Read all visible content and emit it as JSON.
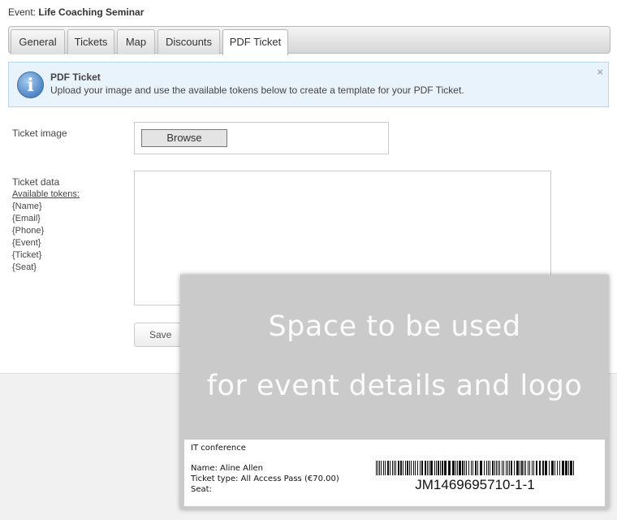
{
  "header": {
    "event_label": "Event:",
    "event_name": "Life Coaching Seminar"
  },
  "tabs": [
    {
      "label": "General"
    },
    {
      "label": "Tickets"
    },
    {
      "label": "Map"
    },
    {
      "label": "Discounts"
    },
    {
      "label": "PDF Ticket",
      "active": true
    }
  ],
  "alert": {
    "icon": "info-icon",
    "title": "PDF Ticket",
    "message": "Upload your image and use the available tokens below to create a template for your PDF Ticket.",
    "close": "×"
  },
  "form": {
    "ticket_image_label": "Ticket image",
    "browse_label": "Browse",
    "ticket_data_label": "Ticket data",
    "available_tokens_label": "Available tokens:",
    "tokens": [
      "{Name}",
      "{Email}",
      "{Phone}",
      "{Event}",
      "{Ticket}",
      "{Seat}"
    ],
    "ticket_data_value": "",
    "save_label": "Save"
  },
  "ticket_preview": {
    "line1": "Space to be used",
    "line2": "for  event details and logo",
    "event": "IT conference",
    "name": "Name: Aline Allen",
    "ticket_type": "Ticket type: All Access Pass (€70.00)",
    "seat": "Seat:",
    "barcode_number": "JM1469695710-1-1"
  },
  "colors": {
    "alert_bg": "#e9f3fb",
    "alert_border": "#b8d7ee",
    "info_icon": "#4f86c6",
    "ticket_bg": "#cacaca"
  }
}
